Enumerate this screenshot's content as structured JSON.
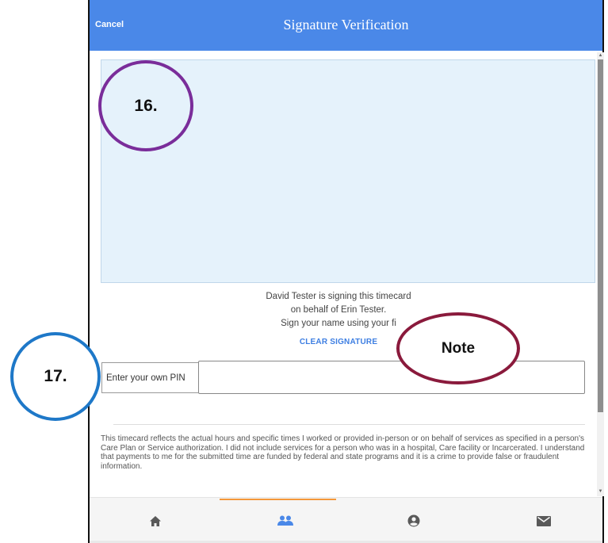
{
  "header": {
    "cancel_label": "Cancel",
    "title": "Signature Verification"
  },
  "signature": {
    "line1": "David Tester is signing this timecard",
    "line2": "on behalf of  Erin Tester.",
    "line3": "Sign your name using your fi",
    "clear_label": "CLEAR SIGNATURE"
  },
  "pin": {
    "label": "Enter your own PIN",
    "value": ""
  },
  "attestation": "This timecard reflects the actual hours and specific times I worked or provided in-person or on behalf of services as specified in a person's Care Plan or Service authorization. I did not include services for a person who was in a hospital, Care facility or Incarcerated. I understand that payments to me for the submitted time are funded by federal and state programs and it is a crime to provide false or fraudulent information.",
  "nav": {
    "items": [
      "home-icon",
      "people-icon",
      "account-icon",
      "mail-icon"
    ],
    "active": "people-icon"
  },
  "callouts": {
    "c16": "16.",
    "c17": "17.",
    "note": "Note"
  },
  "colors": {
    "header": "#4a88e8",
    "signature_pad": "#e5f2fb",
    "accent": "#3d7ee2",
    "active_tab": "#f4983a",
    "callout_16": "#7a2d9a",
    "callout_17": "#1e78c8",
    "callout_note": "#8a1a3c"
  }
}
